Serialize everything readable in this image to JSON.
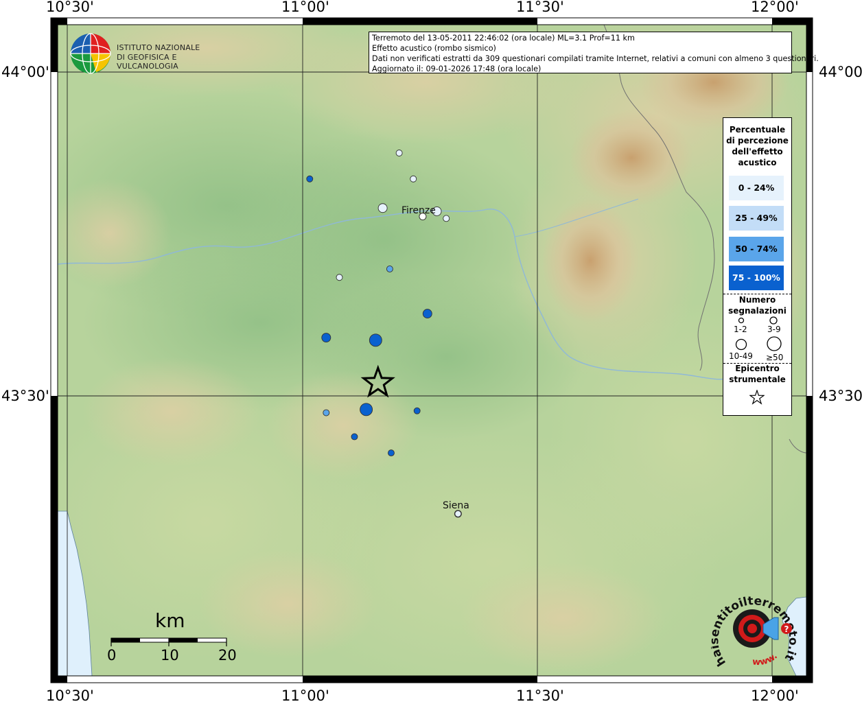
{
  "info": {
    "line1": "Terremoto del 13-05-2011 22:46:02 (ora locale) ML=3.1 Prof=11 km",
    "line2": "Effetto acustico (rombo sismico)",
    "line3": "Dati non verificati estratti da 309 questionari compilati tramite Internet, relativi a comuni con almeno 3 questionari.",
    "line4": "Aggiornato il: 09-01-2026 17:48 (ora locale)"
  },
  "ingv_logo": {
    "line1": "ISTITUTO NAZIONALE",
    "line2": "DI GEOFISICA E VULCANOLOGIA"
  },
  "axes": {
    "lon_ticks": [
      "10°30'",
      "11°00'",
      "11°30'",
      "12°00'"
    ],
    "lat_ticks": [
      "44°00'",
      "43°30'"
    ]
  },
  "cities": {
    "firenze": "Firenze",
    "siena": "Siena"
  },
  "legend": {
    "title_perc": [
      "Percentuale",
      "di percezione",
      "dell'effetto",
      "acustico"
    ],
    "classes": [
      {
        "label": "0 - 24%",
        "color": "#e6f2fc",
        "text_color": "#000000"
      },
      {
        "label": "25 - 49%",
        "color": "#c3ddf7",
        "text_color": "#000000"
      },
      {
        "label": "50 - 74%",
        "color": "#5aa5ea",
        "text_color": "#000000"
      },
      {
        "label": "75 - 100%",
        "color": "#0a61cf",
        "text_color": "#ffffff"
      }
    ],
    "title_num": [
      "Numero",
      "segnalazioni"
    ],
    "size_labels": [
      "1-2",
      "3-9",
      "10-49",
      "≥50"
    ],
    "title_epi": [
      "Epicentro",
      "strumentale"
    ]
  },
  "scale": {
    "unit": "km",
    "labels": [
      "0",
      "10",
      "20"
    ]
  },
  "hs_logo": {
    "text": "haisentitoilterremoto.it",
    "www": "www."
  },
  "colors": {
    "water": "#dff0fc",
    "land_low": "#b6d49b",
    "land_mid": "#9ec78f",
    "hill": "#d8c9a0",
    "mountain": "#c8a574"
  },
  "points": [
    {
      "lon": 11.205,
      "lat": 43.875,
      "pct_class": 0,
      "size_class": 0
    },
    {
      "lon": 11.235,
      "lat": 43.835,
      "pct_class": 0,
      "size_class": 0
    },
    {
      "lon": 11.015,
      "lat": 43.835,
      "pct_class": 3,
      "size_class": 0
    },
    {
      "lon": 11.17,
      "lat": 43.79,
      "pct_class": 0,
      "size_class": 1
    },
    {
      "lon": 11.285,
      "lat": 43.785,
      "pct_class": 0,
      "size_class": 1
    },
    {
      "lon": 11.305,
      "lat": 43.774,
      "pct_class": 0,
      "size_class": 0
    },
    {
      "lon": 11.078,
      "lat": 43.683,
      "pct_class": 0,
      "size_class": 0
    },
    {
      "lon": 11.185,
      "lat": 43.696,
      "pct_class": 2,
      "size_class": 0
    },
    {
      "lon": 11.265,
      "lat": 43.627,
      "pct_class": 3,
      "size_class": 1
    },
    {
      "lon": 11.05,
      "lat": 43.59,
      "pct_class": 3,
      "size_class": 1
    },
    {
      "lon": 11.155,
      "lat": 43.586,
      "pct_class": 3,
      "size_class": 2
    },
    {
      "lon": 11.05,
      "lat": 43.474,
      "pct_class": 2,
      "size_class": 0
    },
    {
      "lon": 11.135,
      "lat": 43.479,
      "pct_class": 3,
      "size_class": 2
    },
    {
      "lon": 11.243,
      "lat": 43.477,
      "pct_class": 3,
      "size_class": 0
    },
    {
      "lon": 11.11,
      "lat": 43.437,
      "pct_class": 3,
      "size_class": 0
    },
    {
      "lon": 11.188,
      "lat": 43.412,
      "pct_class": 3,
      "size_class": 0
    },
    {
      "lon": 11.33,
      "lat": 43.318,
      "pct_class": 0,
      "size_class": 0
    }
  ],
  "epicenter": {
    "lon": 11.16,
    "lat": 43.52
  },
  "city_markers": {
    "firenze": {
      "lon": 11.255,
      "lat": 43.777
    },
    "siena": {
      "lon": 11.33,
      "lat": 43.318
    }
  }
}
